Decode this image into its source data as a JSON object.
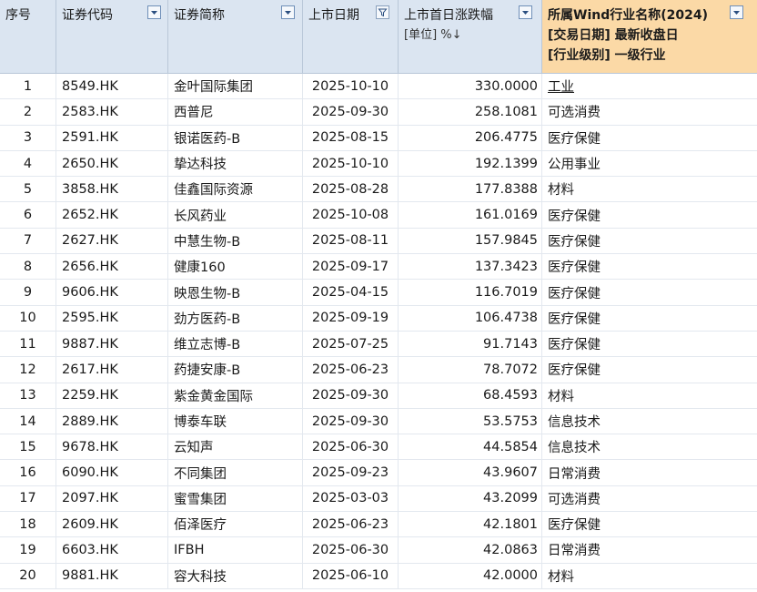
{
  "header": {
    "col_idx": "序号",
    "col_code": "证券代码",
    "col_name": "证券简称",
    "col_date": "上市日期",
    "col_change": "上市首日涨跌幅",
    "col_change_unit": "[单位] %↓",
    "col_industry_line1": "所属Wind行业名称(2024)",
    "col_industry_line2": "[交易日期] 最新收盘日",
    "col_industry_line3": "[行业级别] 一级行业"
  },
  "icons": {
    "filter": "dropdown-filter-icon",
    "funnel": "funnel-filter-icon"
  },
  "rows": [
    {
      "idx": "1",
      "code": "8549.HK",
      "name": "金叶国际集团",
      "date": "2025-10-10",
      "change": "330.0000",
      "industry": "工业"
    },
    {
      "idx": "2",
      "code": "2583.HK",
      "name": "西普尼",
      "date": "2025-09-30",
      "change": "258.1081",
      "industry": "可选消费"
    },
    {
      "idx": "3",
      "code": "2591.HK",
      "name": "银诺医药-B",
      "date": "2025-08-15",
      "change": "206.4775",
      "industry": "医疗保健"
    },
    {
      "idx": "4",
      "code": "2650.HK",
      "name": "挚达科技",
      "date": "2025-10-10",
      "change": "192.1399",
      "industry": "公用事业"
    },
    {
      "idx": "5",
      "code": "3858.HK",
      "name": "佳鑫国际资源",
      "date": "2025-08-28",
      "change": "177.8388",
      "industry": "材料"
    },
    {
      "idx": "6",
      "code": "2652.HK",
      "name": "长风药业",
      "date": "2025-10-08",
      "change": "161.0169",
      "industry": "医疗保健"
    },
    {
      "idx": "7",
      "code": "2627.HK",
      "name": "中慧生物-B",
      "date": "2025-08-11",
      "change": "157.9845",
      "industry": "医疗保健"
    },
    {
      "idx": "8",
      "code": "2656.HK",
      "name": "健康160",
      "date": "2025-09-17",
      "change": "137.3423",
      "industry": "医疗保健"
    },
    {
      "idx": "9",
      "code": "9606.HK",
      "name": "映恩生物-B",
      "date": "2025-04-15",
      "change": "116.7019",
      "industry": "医疗保健"
    },
    {
      "idx": "10",
      "code": "2595.HK",
      "name": "劲方医药-B",
      "date": "2025-09-19",
      "change": "106.4738",
      "industry": "医疗保健"
    },
    {
      "idx": "11",
      "code": "9887.HK",
      "name": "维立志博-B",
      "date": "2025-07-25",
      "change": "91.7143",
      "industry": "医疗保健"
    },
    {
      "idx": "12",
      "code": "2617.HK",
      "name": "药捷安康-B",
      "date": "2025-06-23",
      "change": "78.7072",
      "industry": "医疗保健"
    },
    {
      "idx": "13",
      "code": "2259.HK",
      "name": "紫金黄金国际",
      "date": "2025-09-30",
      "change": "68.4593",
      "industry": "材料"
    },
    {
      "idx": "14",
      "code": "2889.HK",
      "name": "博泰车联",
      "date": "2025-09-30",
      "change": "53.5753",
      "industry": "信息技术"
    },
    {
      "idx": "15",
      "code": "9678.HK",
      "name": "云知声",
      "date": "2025-06-30",
      "change": "44.5854",
      "industry": "信息技术"
    },
    {
      "idx": "16",
      "code": "6090.HK",
      "name": "不同集团",
      "date": "2025-09-23",
      "change": "43.9607",
      "industry": "日常消费"
    },
    {
      "idx": "17",
      "code": "2097.HK",
      "name": "蜜雪集团",
      "date": "2025-03-03",
      "change": "43.2099",
      "industry": "可选消费"
    },
    {
      "idx": "18",
      "code": "2609.HK",
      "name": "佰泽医疗",
      "date": "2025-06-23",
      "change": "42.1801",
      "industry": "医疗保健"
    },
    {
      "idx": "19",
      "code": "6603.HK",
      "name": "IFBH",
      "date": "2025-06-30",
      "change": "42.0863",
      "industry": "日常消费"
    },
    {
      "idx": "20",
      "code": "9881.HK",
      "name": "容大科技",
      "date": "2025-06-10",
      "change": "42.0000",
      "industry": "材料"
    }
  ]
}
